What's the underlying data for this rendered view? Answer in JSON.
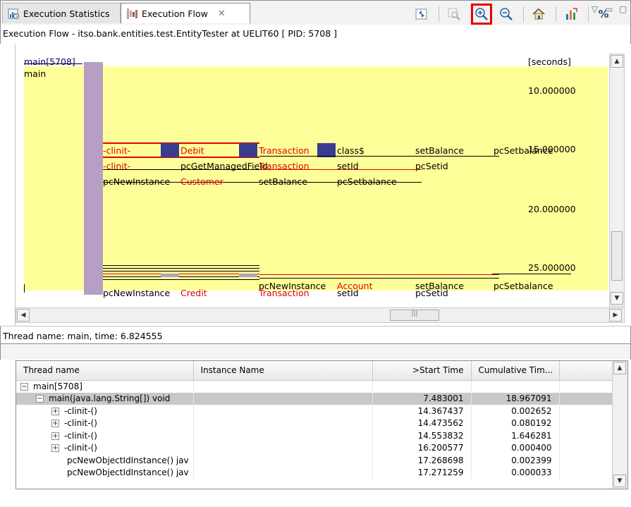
{
  "tabs": [
    {
      "label": "Execution Statistics",
      "icon": "execution-statistics-icon"
    },
    {
      "label": "Execution Flow",
      "icon": "execution-flow-icon"
    }
  ],
  "toolbar": {
    "buttons": [
      "sync-icon",
      "zoom-fit-icon",
      "zoom-in-icon",
      "zoom-out-icon",
      "home-icon",
      "chart-icon"
    ],
    "percent_label": "%",
    "active_button": "zoom-in-icon",
    "highlight_color": "#e60000"
  },
  "view_title": "Execution Flow - itso.bank.entities.test.EntityTester at UELIT60 [ PID: 5708 ]",
  "flow": {
    "thread_header": "main[5708]",
    "thread_label": "main",
    "seconds_label": "[seconds]",
    "time_marks": [
      "10.000000",
      "15.000000",
      "20.000000",
      "25.000000"
    ],
    "row1": [
      "-clinit-",
      "Debit",
      "Transaction",
      "class$",
      "setBalance",
      "pcSetbalance"
    ],
    "row2": [
      "-clinit-",
      "pcGetManagedField",
      "Transaction",
      "setId",
      "pcSetid"
    ],
    "row3": [
      "pcNewInstance",
      "Customer",
      "setBalance",
      "pcSetbalance"
    ],
    "bottom_row": [
      "pcNewInstance",
      "Credit",
      "pcNewInstance",
      "Account",
      "setBalance",
      "pcSetbalance"
    ],
    "bottom_row2": [
      "Transaction",
      "setId",
      "pcSetid"
    ],
    "colors": {
      "background": "#ffff99",
      "main_bar": "#b79ec4",
      "block": "#3b3b8f",
      "red": "#e00000"
    }
  },
  "status_text": "Thread name: main, time: 6.824555",
  "table": {
    "columns": [
      "Thread name",
      "Instance Name",
      ">Start Time",
      "Cumulative Tim..."
    ],
    "rows": [
      {
        "name": "main[5708]",
        "expander": "−",
        "indent": 0,
        "instance": "",
        "start": "",
        "cumulative": "",
        "selected": false
      },
      {
        "name": "main(java.lang.String[]) void",
        "expander": "−",
        "indent": 1,
        "instance": "",
        "start": "7.483001",
        "cumulative": "18.967091",
        "selected": true
      },
      {
        "name": "-clinit-()",
        "expander": "+",
        "indent": 2,
        "instance": "",
        "start": "14.367437",
        "cumulative": "0.002652",
        "selected": false
      },
      {
        "name": "-clinit-()",
        "expander": "+",
        "indent": 2,
        "instance": "",
        "start": "14.473562",
        "cumulative": "0.080192",
        "selected": false
      },
      {
        "name": "-clinit-()",
        "expander": "+",
        "indent": 2,
        "instance": "",
        "start": "14.553832",
        "cumulative": "1.646281",
        "selected": false
      },
      {
        "name": "-clinit-()",
        "expander": "+",
        "indent": 2,
        "instance": "",
        "start": "16.200577",
        "cumulative": "0.000400",
        "selected": false
      },
      {
        "name": "pcNewObjectIdInstance() jav",
        "expander": "",
        "indent": 3,
        "instance": "",
        "start": "17.268698",
        "cumulative": "0.002399",
        "selected": false
      },
      {
        "name": "pcNewObjectIdInstance() jav",
        "expander": "",
        "indent": 3,
        "instance": "",
        "start": "17.271259",
        "cumulative": "0.000033",
        "selected": false
      }
    ]
  }
}
